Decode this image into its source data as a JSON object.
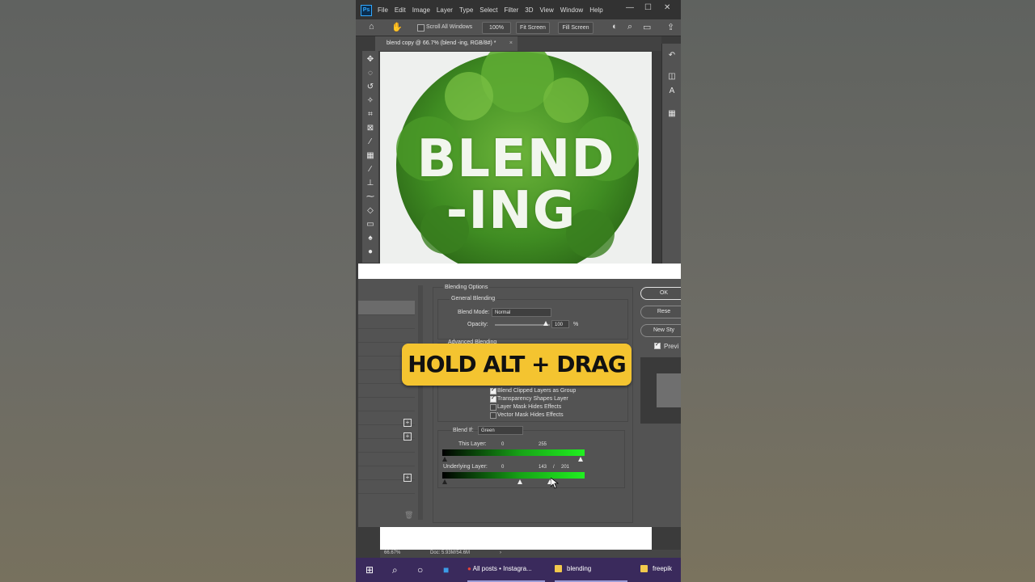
{
  "menu": {
    "app_logo": "Ps",
    "items": [
      "File",
      "Edit",
      "Image",
      "Layer",
      "Type",
      "Select",
      "Filter",
      "3D",
      "View",
      "Window",
      "Help"
    ],
    "window_controls": [
      "—",
      "☐",
      "✕"
    ]
  },
  "options_bar": {
    "scroll_all_windows": "Scroll All Windows",
    "zoom": "100%",
    "fit_screen": "Fit Screen",
    "fill_screen": "Fill Screen"
  },
  "document_tab": {
    "title": "blend copy @ 66.7% (blend -ing, RGB/8#) *",
    "close": "×"
  },
  "canvas": {
    "line1": "BLEND",
    "line2": "-ING",
    "tree_color": "#4f9a2a"
  },
  "dialog": {
    "blending_options": "Blending Options",
    "general_blending": "General Blending",
    "blend_mode_label": "Blend Mode:",
    "blend_mode_value": "Normal",
    "opacity_label": "Opacity:",
    "opacity_value": "100",
    "opacity_unit": "%",
    "advanced_blending": "Advanced Blending",
    "checkboxes": [
      {
        "label": "Blend Clipped Layers as Group",
        "checked": true
      },
      {
        "label": "Transparency Shapes Layer",
        "checked": true
      },
      {
        "label": "Layer Mask Hides Effects",
        "checked": false
      },
      {
        "label": "Vector Mask Hides Effects",
        "checked": false
      }
    ],
    "blend_if_label": "Blend If:",
    "blend_if_value": "Green",
    "this_layer_label": "This Layer:",
    "this_layer_low": "0",
    "this_layer_high": "255",
    "underlying_label": "Underlying Layer:",
    "underlying_low": "0",
    "underlying_mid": "143",
    "underlying_sep": "/",
    "underlying_high": "201",
    "buttons": {
      "ok": "OK",
      "reset": "Rese",
      "new_style": "New Sty",
      "preview": "Previ"
    }
  },
  "banner": {
    "text": "HOLD ALT + DRAG",
    "color": "#f4c430"
  },
  "status": {
    "zoom": "66.67%",
    "doc": "Doc: 5.93M/54.6M",
    "arrow": "›"
  },
  "taskbar": {
    "items": [
      {
        "label": "All posts • Instagra..."
      },
      {
        "label": "blending"
      },
      {
        "label": "freepik"
      }
    ]
  }
}
